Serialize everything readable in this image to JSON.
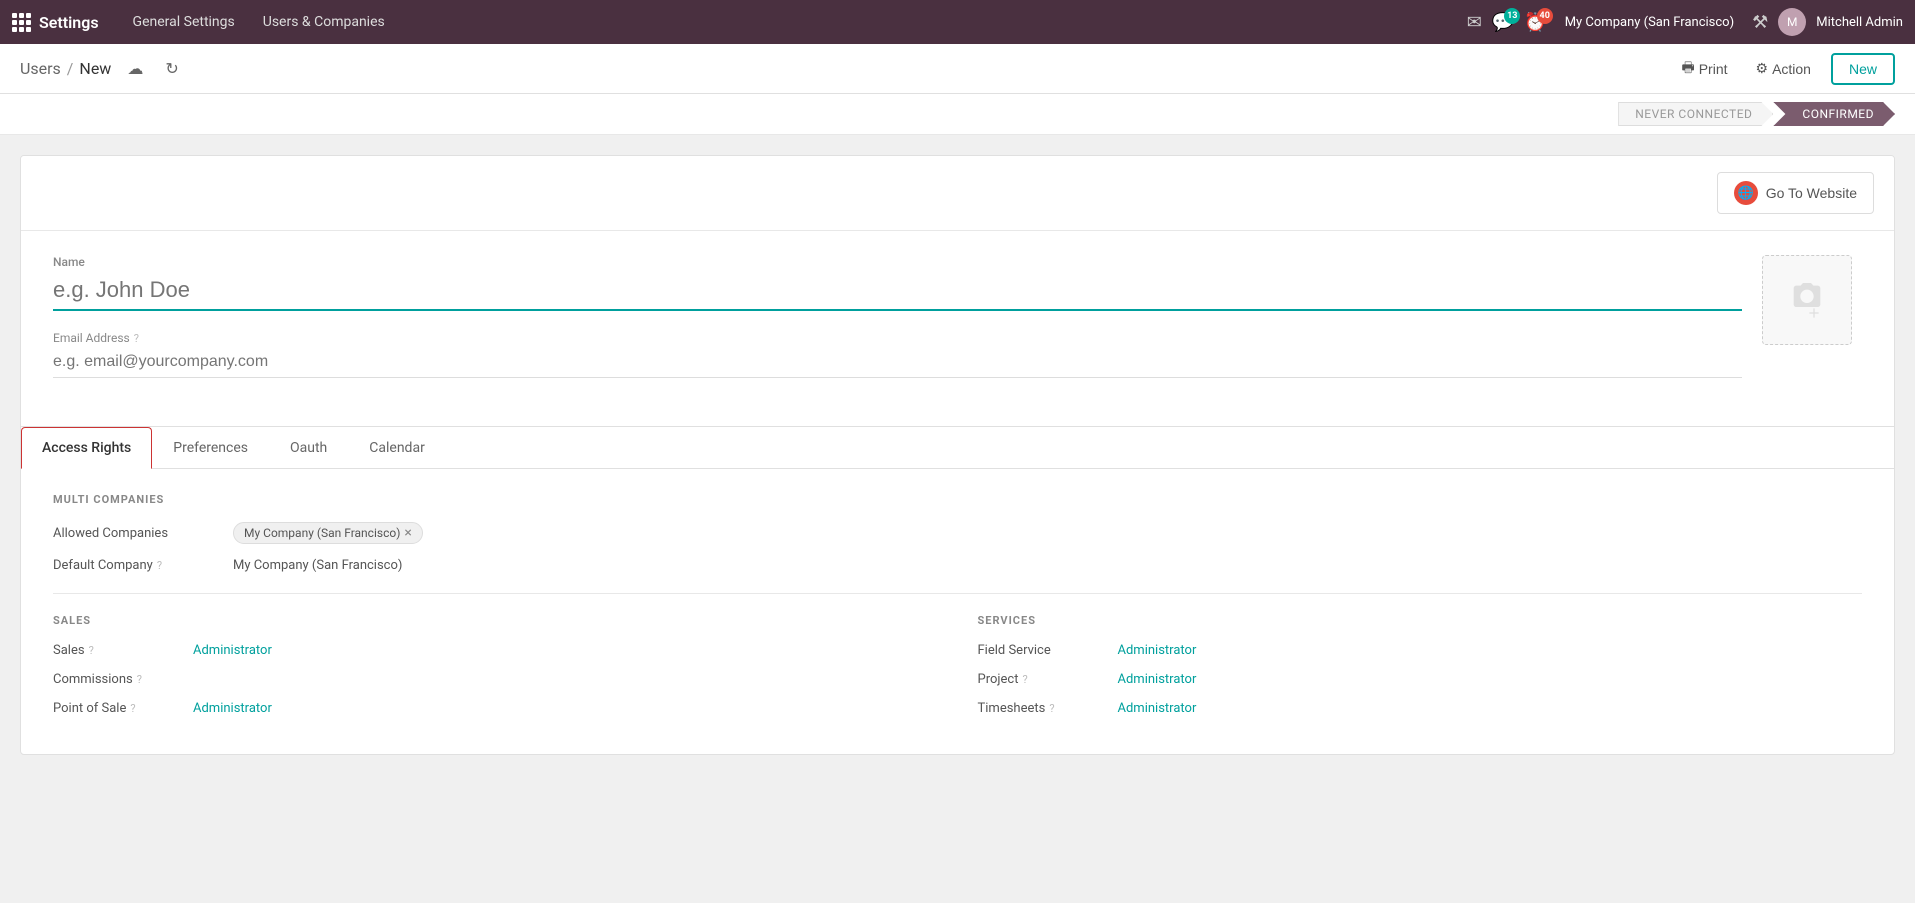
{
  "topnav": {
    "app_title": "Settings",
    "nav_items": [
      {
        "label": "General Settings"
      },
      {
        "label": "Users & Companies"
      }
    ],
    "notifications_count": "13",
    "clock_count": "40",
    "company": "My Company (San Francisco)",
    "user": "Mitchell Admin"
  },
  "breadcrumb": {
    "parent": "Users",
    "separator": "/",
    "current": "New"
  },
  "toolbar": {
    "print_label": "Print",
    "action_label": "Action",
    "new_label": "New"
  },
  "status": {
    "steps": [
      {
        "label": "NEVER CONNECTED",
        "active": false
      },
      {
        "label": "CONFIRMED",
        "active": true
      }
    ]
  },
  "form": {
    "go_to_website": "Go To Website",
    "name_label": "Name",
    "name_placeholder": "e.g. John Doe",
    "email_label": "Email Address",
    "email_placeholder": "e.g. email@yourcompany.com"
  },
  "tabs": [
    {
      "label": "Access Rights",
      "active": true
    },
    {
      "label": "Preferences",
      "active": false
    },
    {
      "label": "Oauth",
      "active": false
    },
    {
      "label": "Calendar",
      "active": false
    }
  ],
  "access_rights": {
    "multi_companies_title": "MULTI COMPANIES",
    "allowed_companies_label": "Allowed Companies",
    "allowed_companies_value": "My Company (San Francisco)",
    "default_company_label": "Default Company",
    "default_company_help": "?",
    "default_company_value": "My Company (San Francisco)",
    "sales_title": "SALES",
    "sales_fields": [
      {
        "label": "Sales",
        "help": true,
        "value": "Administrator"
      },
      {
        "label": "Commissions",
        "help": true,
        "value": ""
      },
      {
        "label": "Point of Sale",
        "help": true,
        "value": "Administrator"
      }
    ],
    "services_title": "SERVICES",
    "services_fields": [
      {
        "label": "Field Service",
        "help": false,
        "value": "Administrator"
      },
      {
        "label": "Project",
        "help": true,
        "value": "Administrator"
      },
      {
        "label": "Timesheets",
        "help": true,
        "value": "Administrator"
      }
    ]
  }
}
